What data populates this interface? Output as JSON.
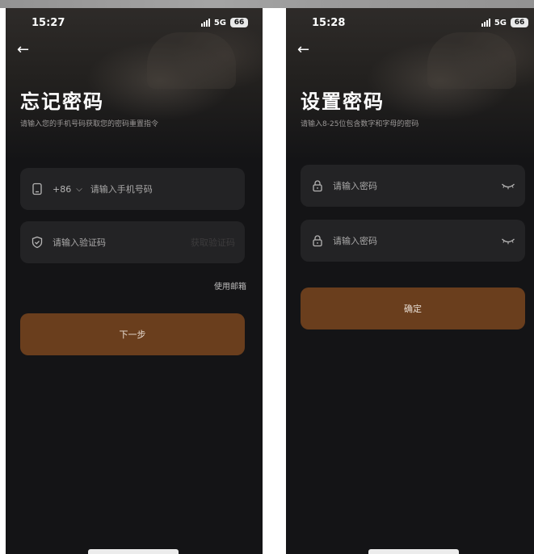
{
  "left_screen": {
    "status": {
      "time": "15:27",
      "network": "5G",
      "battery": "66"
    },
    "title": "忘记密码",
    "subtitle": "请输入您的手机号码获取您的密码重置指令",
    "phone_field": {
      "country_code": "+86",
      "placeholder": "请输入手机号码"
    },
    "code_field": {
      "placeholder": "请输入验证码",
      "get_code": "获取验证码"
    },
    "alt_link": "使用邮箱",
    "next_button": "下一步"
  },
  "right_screen": {
    "status": {
      "time": "15:28",
      "network": "5G",
      "battery": "66"
    },
    "title": "设置密码",
    "subtitle": "请输入8-25位包含数字和字母的密码",
    "password_field": {
      "placeholder": "请输入密码"
    },
    "confirm_field": {
      "placeholder": "请输入密码"
    },
    "confirm_button": "确定"
  },
  "icons": {
    "back": "arrow-left-icon",
    "phone": "phone-icon",
    "shield": "shield-check-icon",
    "lock": "lock-icon",
    "eye_closed": "eye-closed-icon",
    "chevron": "chevron-down-icon"
  },
  "colors": {
    "background": "#141416",
    "field": "#232325",
    "primary_button": "#6a3e1d"
  }
}
